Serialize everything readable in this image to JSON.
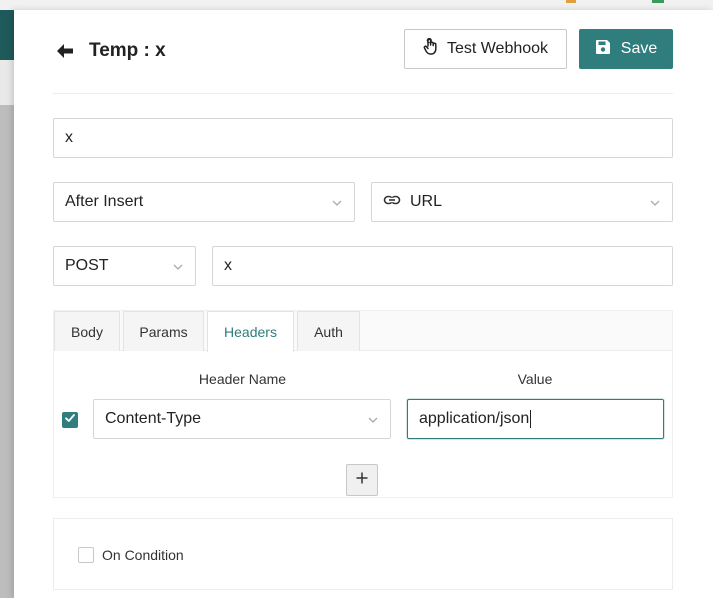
{
  "header": {
    "title": "Temp : x",
    "test_label": "Test Webhook",
    "save_label": "Save"
  },
  "form": {
    "name_value": "x",
    "event_value": "After Insert",
    "notification_type": "URL",
    "method_value": "POST",
    "url_value": "x"
  },
  "tabs": [
    {
      "label": "Body",
      "active": false
    },
    {
      "label": "Params",
      "active": false
    },
    {
      "label": "Headers",
      "active": true
    },
    {
      "label": "Auth",
      "active": false
    }
  ],
  "headers_table": {
    "col_name": "Header Name",
    "col_value": "Value",
    "rows": [
      {
        "enabled": true,
        "name": "Content-Type",
        "value": "application/json"
      }
    ],
    "add_label": "+"
  },
  "condition": {
    "label": "On Condition",
    "checked": false
  },
  "colors": {
    "accent": "#2f7d7d",
    "border": "#d6d6d6"
  },
  "icons": [
    "arrow-left-icon",
    "hand-pointer-icon",
    "save-icon",
    "link-icon",
    "chevron-down-icon",
    "check-icon",
    "plus-icon"
  ]
}
